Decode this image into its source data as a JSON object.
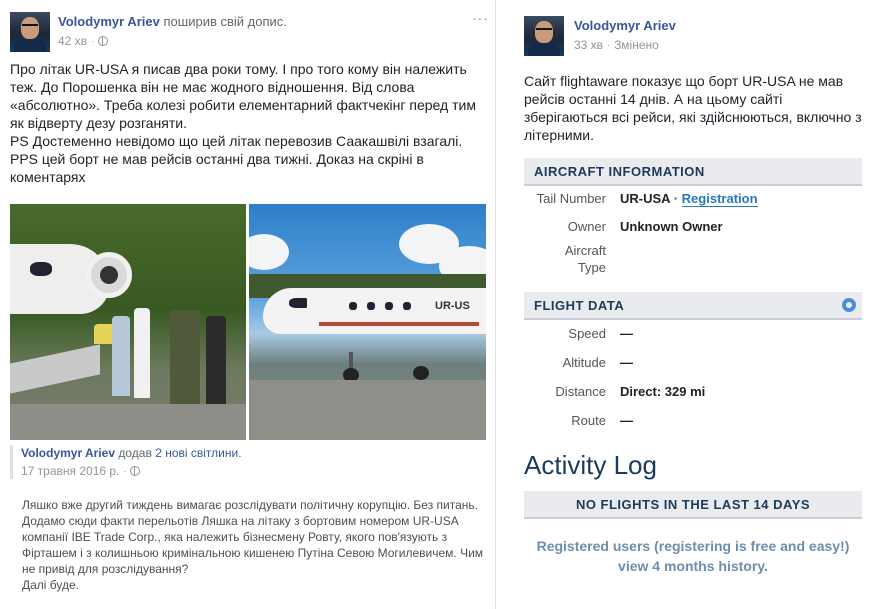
{
  "left_post": {
    "author": "Volodymyr Ariev",
    "action": "поширив свій допис.",
    "time": "42 хв",
    "text": [
      "Про літак UR-USA я писав два роки тому. І про того кому він належить теж. До Порошенка він не має жодного відношення. Від слова «абсолютно». Треба колезі робити елементарний фактчекінг перед тим як відверту дезу розганяти.",
      "PS Достеменно невідомо що цей літак перевозив Саакашвілі взагалі.",
      "PPS цей борт не мав рейсів останні два тижні. Доказ на скріні в коментарях"
    ],
    "shared": {
      "author": "Volodymyr Ariev",
      "action_pre": "додав",
      "action_link": "2 нові світлини",
      "action_post": ".",
      "date": "17 травня 2016 р.",
      "text": [
        "Ляшко вже другий тиждень вимагає розслідувати політичну корупцію. Без питань. Додамо сюди факти перельотів Ляшка на літаку з бортовим номером UR-USA компанії IBE Trade Corp., яка належить бізнесмену Ровту, якого пов'язують з Фірташем і з колишньою кримінальною кишенею Путіна Севою Могилевичем. Чим не привід для розслідування?",
        "Далі буде."
      ]
    },
    "photo_b_reg": "UR-US"
  },
  "right_post": {
    "author": "Volodymyr Ariev",
    "time": "33 хв",
    "edited": "Змінено",
    "text": "Сайт flightaware показує що борт UR-USA не мав рейсів останні 14 днів. А на цьому сайті зберігаються всі рейси, які здійснюються, включно з літерними.",
    "aircraft_info": {
      "header": "AIRCRAFT INFORMATION",
      "rows": [
        {
          "label": "Tail Number",
          "value": "UR-USA",
          "sep": "·",
          "link": "Registration"
        },
        {
          "label": "Owner",
          "value": "Unknown Owner"
        },
        {
          "label": "Aircraft Type",
          "value": ""
        }
      ]
    },
    "flight_data": {
      "header": "FLIGHT DATA",
      "rows": [
        {
          "label": "Speed",
          "value": "—"
        },
        {
          "label": "Altitude",
          "value": "—"
        },
        {
          "label": "Distance",
          "value": "Direct: 329 mi"
        },
        {
          "label": "Route",
          "value": "—"
        }
      ]
    },
    "activity_log": {
      "title": "Activity Log",
      "banner": "NO FLIGHTS IN THE LAST 14 DAYS",
      "note": "Registered users (registering is free and easy!) view 4 months history."
    }
  },
  "colors": {
    "link": "#365899",
    "fa_navy": "#1b3a5c",
    "fa_link": "#2878c0",
    "muted": "#90949c"
  },
  "icons": [
    "more-icon",
    "globe-icon",
    "gear-icon"
  ]
}
